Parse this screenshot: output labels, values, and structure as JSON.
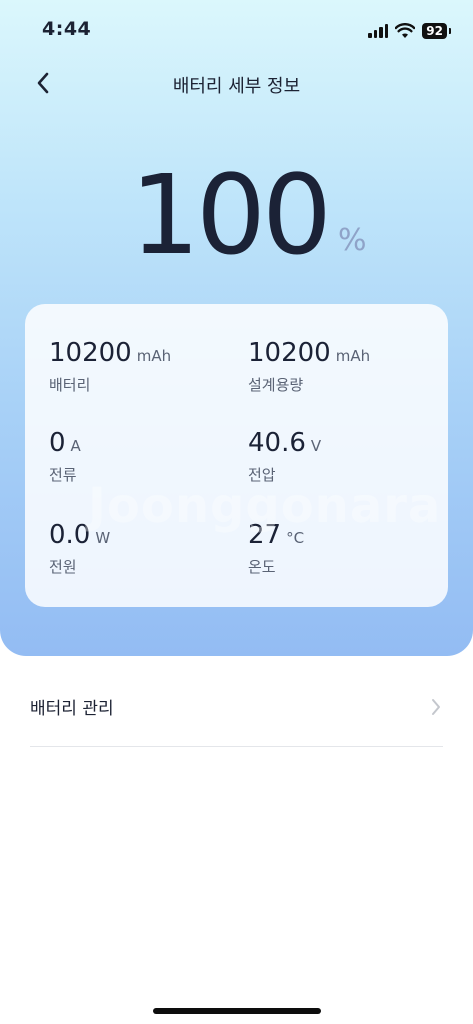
{
  "status_bar": {
    "time": "4:44",
    "battery": "92",
    "icons": [
      "signal-icon",
      "wifi-icon",
      "battery-icon"
    ]
  },
  "header": {
    "title": "배터리 세부 정보",
    "back_icon": "chevron-left-icon"
  },
  "battery_level": {
    "value": "100",
    "unit": "%"
  },
  "stats": [
    {
      "value": "10200",
      "unit": "mAh",
      "label": "배터리"
    },
    {
      "value": "10200",
      "unit": "mAh",
      "label": "설계용량"
    },
    {
      "value": "0",
      "unit": "A",
      "label": "전류"
    },
    {
      "value": "40.6",
      "unit": "V",
      "label": "전압"
    },
    {
      "value": "0.0",
      "unit": "W",
      "label": "전원"
    },
    {
      "value": "27",
      "unit": "°C",
      "label": "온도"
    }
  ],
  "watermark": "Joonggonara",
  "menu": {
    "battery_manage_label": "배터리 관리",
    "chevron_icon": "chevron-right-icon"
  },
  "colors": {
    "gradient_top": "#dbf7fc",
    "gradient_bottom": "#93bcf3",
    "text_primary": "#1b2236",
    "unit_accent": "#8fa3c8"
  }
}
